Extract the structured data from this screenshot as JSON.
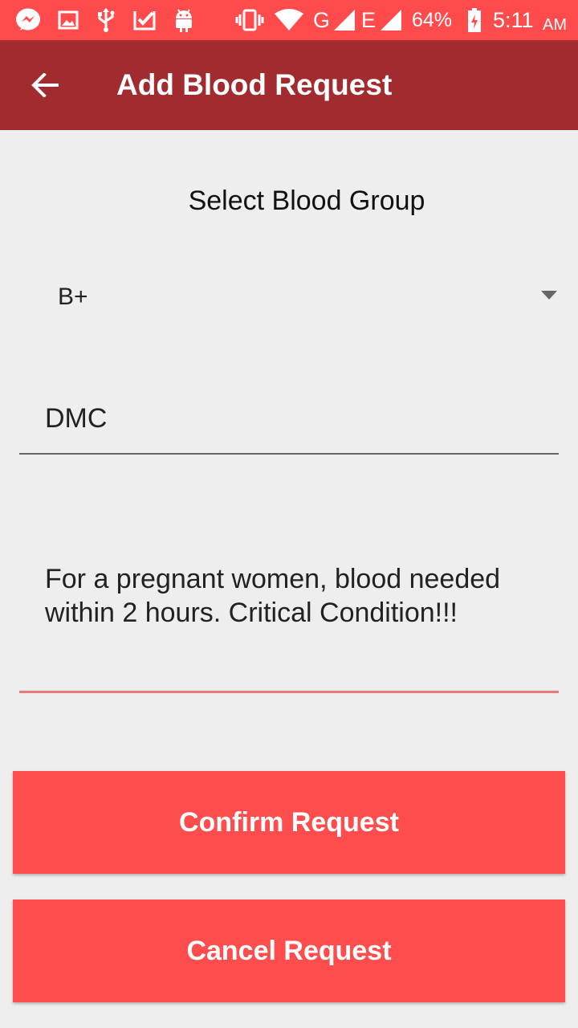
{
  "status_bar": {
    "network_g": "G",
    "network_e": "E",
    "battery_percent": "64%",
    "time": "5:11",
    "ampm": "AM",
    "icons": [
      "messenger-icon",
      "gallery-icon",
      "usb-icon",
      "check-app-icon",
      "android-icon",
      "vibrate-icon",
      "wifi-icon",
      "signal-icon",
      "signal-icon",
      "battery-charging-icon"
    ]
  },
  "app_bar": {
    "title": "Add Blood Request",
    "back_icon": "back-arrow-icon"
  },
  "form": {
    "blood_group_label": "Select Blood Group",
    "blood_group_selected": "B+",
    "hospital_value": "DMC",
    "details_value": "For a pregnant women, blood needed within 2 hours. Critical Condition!!!"
  },
  "buttons": {
    "confirm_label": "Confirm Request",
    "cancel_label": "Cancel Request"
  },
  "colors": {
    "status_bar": "#ff4b4b",
    "app_bar": "#a12b2e",
    "button": "#ff4c4c",
    "active_underline": "#f07878",
    "background": "#eeeeee"
  }
}
